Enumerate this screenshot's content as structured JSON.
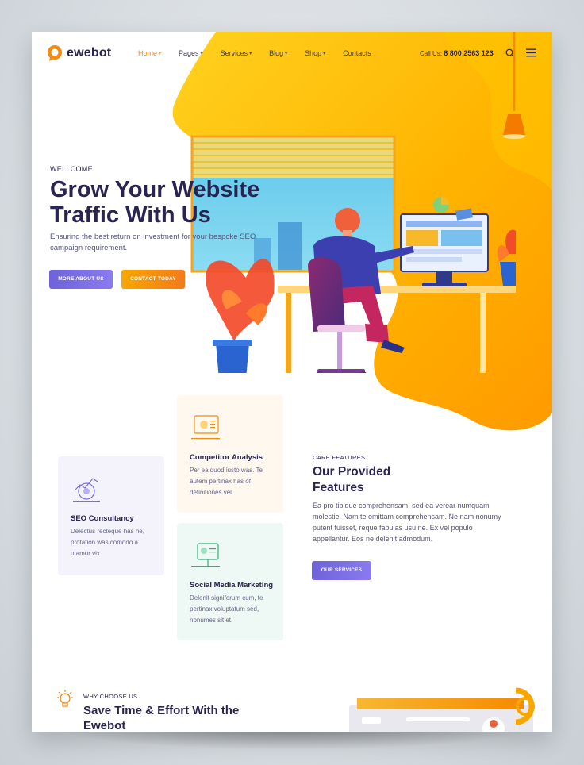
{
  "brand": {
    "logo_text": "ewebot",
    "accent": "#f28a13",
    "primary_dark": "#2a2550",
    "purple": "#7a6de6"
  },
  "nav": {
    "items": [
      {
        "label": "Home",
        "active": true
      },
      {
        "label": "Pages"
      },
      {
        "label": "Services"
      },
      {
        "label": "Blog"
      },
      {
        "label": "Shop"
      },
      {
        "label": "Contacts"
      }
    ],
    "call_label": "Call Us:",
    "call_number": "8 800 2563 123"
  },
  "hero": {
    "eyebrow": "WELLCOME",
    "title": "Grow Your Website Traffic With Us",
    "subtitle": "Ensuring the best return on investment for your bespoke SEO campaign requirement.",
    "btn_about": "MORE ABOUT US",
    "btn_contact": "CONTACT TODAY"
  },
  "services": {
    "cards": [
      {
        "title": "SEO Consultancy",
        "text": "Delectus recteque has ne, protation was comodo a utamur vix."
      },
      {
        "title": "Competitor Analysis",
        "text": "Per ea quod iusto was. Te autem pertinax has of definitiones vel."
      },
      {
        "title": "Social Media Marketing",
        "text": "Delenit signiferum cum, te pertinax voluptatum sed, nonumes sit et."
      }
    ]
  },
  "features": {
    "eyebrow": "CARE FEATURES",
    "title": "Our Provided Features",
    "text": "Ea pro tibique comprehensam, sed ea verear numquam molestie. Nam te omittam comprehensam. Ne nam nonumy putent fuisset, reque fabulas usu ne. Ex vel populo appellantur. Eos ne delenit admodum.",
    "btn_services": "OUR SERVICES"
  },
  "why": {
    "eyebrow": "WHY CHOOSE US",
    "title": "Save Time & Effort With the Ewebot"
  }
}
